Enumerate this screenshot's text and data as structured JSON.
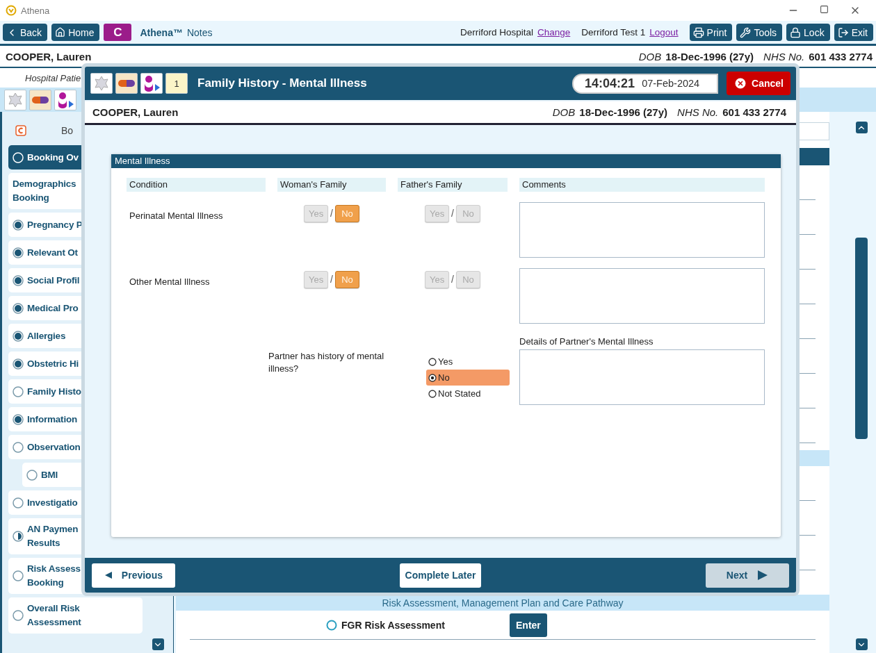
{
  "window": {
    "title": "Athena"
  },
  "toolbar": {
    "back": "Back",
    "home": "Home",
    "badge": "C",
    "app_name": "Athena™",
    "app_suffix": "Notes",
    "location": "Derriford Hospital",
    "change_link": "Change",
    "user": "Derriford Test 1",
    "logout_link": "Logout",
    "buttons": [
      {
        "label": "Print"
      },
      {
        "label": "Tools"
      },
      {
        "label": "Lock"
      },
      {
        "label": "Exit"
      }
    ]
  },
  "patient": {
    "name": "COOPER, Lauren",
    "dob_label": "DOB",
    "dob": "18-Dec-1996 (27y)",
    "nhs_label": "NHS No.",
    "nhs": "601 433 2774"
  },
  "patient_subline": "Hospital Patie",
  "sidebar": {
    "heading": "Bo",
    "items": [
      {
        "label": "Booking Ov",
        "kind": "empty",
        "selected": true
      },
      {
        "label": "Demographics\nBooking",
        "kind": "plain",
        "selected": false
      },
      {
        "label": "Pregnancy P",
        "kind": "complete",
        "selected": false
      },
      {
        "label": "Relevant Ot",
        "kind": "complete",
        "selected": false
      },
      {
        "label": "Social Profil",
        "kind": "complete",
        "selected": false
      },
      {
        "label": "Medical Pro",
        "kind": "complete",
        "selected": false
      },
      {
        "label": "Allergies",
        "kind": "complete",
        "selected": false
      },
      {
        "label": "Obstetric Hi",
        "kind": "complete",
        "selected": false
      },
      {
        "label": "Family Histo",
        "kind": "empty",
        "selected": false
      },
      {
        "label": "Information",
        "kind": "complete",
        "selected": false
      },
      {
        "label": "Observation",
        "kind": "empty",
        "selected": false,
        "children": [
          {
            "label": "BMI",
            "kind": "empty",
            "selected": false
          }
        ]
      },
      {
        "label": "Investigatio",
        "kind": "empty",
        "selected": false
      },
      {
        "label": "AN Paymen\nResults",
        "kind": "partial",
        "selected": false
      },
      {
        "label": "Risk Assess\nBooking",
        "kind": "empty",
        "selected": false
      },
      {
        "label": "Overall Risk\nAssessment",
        "kind": "empty",
        "selected": false
      }
    ]
  },
  "main": {
    "section_heading": "Risk Assessment, Management Plan and Care Pathway",
    "rows": [
      {
        "label": "FGR Risk Assessment",
        "button": "Enter"
      }
    ]
  },
  "dialog": {
    "title": "Family History - Mental Illness",
    "notes_number": "1",
    "time": "14:04:21",
    "date": "07-Feb-2024",
    "cancel": "Cancel",
    "patient": {
      "name": "COOPER, Lauren",
      "dob_label": "DOB",
      "dob": "18-Dec-1996 (27y)",
      "nhs_label": "NHS No.",
      "nhs": "601 433 2774"
    },
    "section": {
      "title": "Mental Illness",
      "columns": [
        "Condition",
        "Woman's Family",
        "Father's Family",
        "Comments"
      ],
      "rows": [
        {
          "condition": "Perinatal Mental Illness",
          "woman": {
            "separator": "/",
            "options": [
              {
                "label": "Yes",
                "selected": false
              },
              {
                "label": "No",
                "selected": true
              }
            ]
          },
          "father": {
            "separator": "/",
            "options": [
              {
                "label": "Yes",
                "selected": false
              },
              {
                "label": "No",
                "selected": false
              }
            ]
          }
        },
        {
          "condition": "Other Mental Illness",
          "woman": {
            "separator": "/",
            "options": [
              {
                "label": "Yes",
                "selected": false
              },
              {
                "label": "No",
                "selected": true
              }
            ]
          },
          "father": {
            "separator": "/",
            "options": [
              {
                "label": "Yes",
                "selected": false
              },
              {
                "label": "No",
                "selected": false
              }
            ]
          }
        }
      ],
      "partner": {
        "question": "Partner has history of mental illness?",
        "options": [
          {
            "label": "Yes",
            "selected": false
          },
          {
            "label": "No",
            "selected": true
          },
          {
            "label": "Not Stated",
            "selected": false
          }
        ],
        "details_label": "Details of Partner's Mental Illness"
      }
    },
    "footer": {
      "previous": "Previous",
      "complete_later": "Complete Later",
      "next": {
        "label": "Next",
        "disabled": true
      }
    }
  }
}
